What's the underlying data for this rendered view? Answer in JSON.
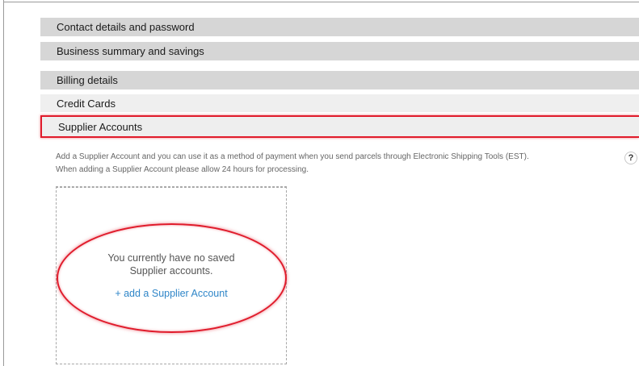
{
  "sections": {
    "contact": "Contact details and password",
    "business": "Business summary and savings",
    "billing": "Billing details",
    "credit": "Credit Cards",
    "supplier": "Supplier Accounts"
  },
  "supplier_panel": {
    "description_line1": "Add a Supplier Account and you can use it as a method of payment when you send parcels through Electronic Shipping Tools (EST).",
    "description_line2": "When adding a Supplier Account please allow 24 hours for processing.",
    "help_icon": "?",
    "empty_line1": "You currently have no saved",
    "empty_line2": "Supplier accounts.",
    "add_link": "+ add a Supplier Account"
  },
  "colors": {
    "highlight": "#e01b2b",
    "link": "#2f86c8",
    "section_bar": "#d6d6d6"
  }
}
